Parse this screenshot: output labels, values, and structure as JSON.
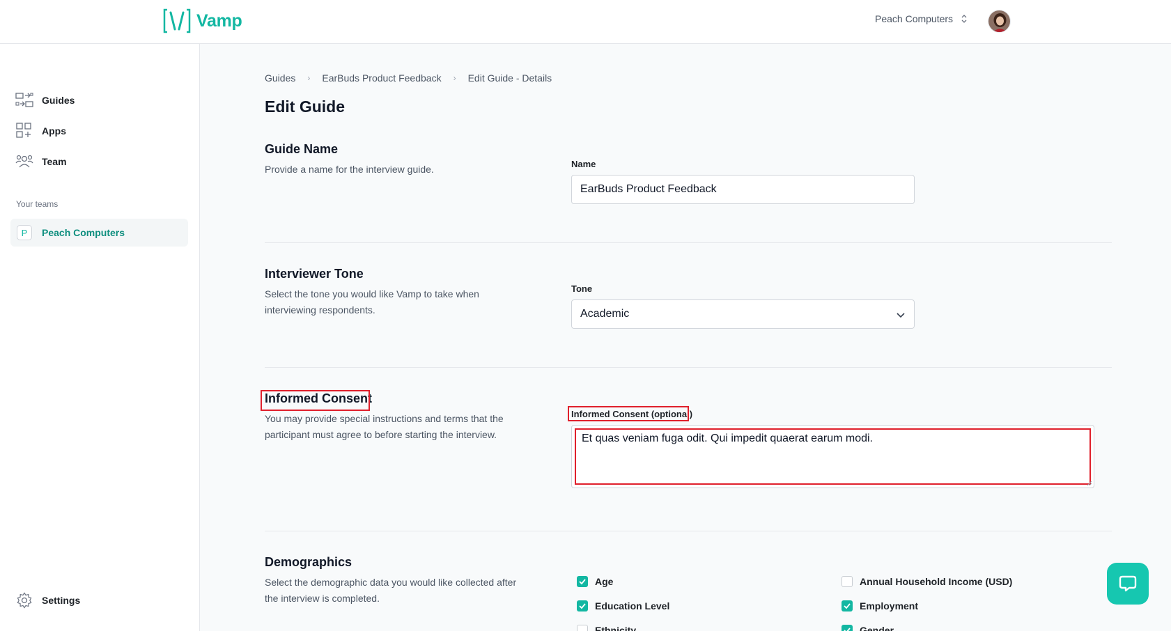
{
  "header": {
    "logo_text": "Vamp",
    "org_name": "Peach Computers",
    "brand_color": "#13b7a2"
  },
  "sidebar": {
    "items": [
      {
        "label": "Guides",
        "icon": "guides-icon"
      },
      {
        "label": "Apps",
        "icon": "apps-grid-icon"
      },
      {
        "label": "Team",
        "icon": "team-icon"
      }
    ],
    "teams_caption": "Your teams",
    "team": {
      "badge": "P",
      "label": "Peach Computers"
    },
    "settings_label": "Settings"
  },
  "breadcrumb": [
    "Guides",
    "EarBuds Product Feedback",
    "Edit Guide - Details"
  ],
  "page_title": "Edit Guide",
  "sections": {
    "guide_name": {
      "title": "Guide Name",
      "description": "Provide a name for the interview guide.",
      "field_label": "Name",
      "value": "EarBuds Product Feedback"
    },
    "tone": {
      "title": "Interviewer Tone",
      "description": "Select the tone you would like Vamp to take when interviewing respondents.",
      "field_label": "Tone",
      "value": "Academic"
    },
    "consent": {
      "title": "Informed Consent",
      "description": "You may provide special instructions and terms that the participant must agree to before starting the interview.",
      "field_label": "Informed Consent (optional)",
      "value": "Et quas veniam fuga odit. Qui impedit quaerat earum modi."
    },
    "demographics": {
      "title": "Demographics",
      "description": "Select the demographic data you would like collected after the interview is completed.",
      "options": [
        {
          "label": "Age",
          "checked": true
        },
        {
          "label": "Annual Household Income (USD)",
          "checked": false
        },
        {
          "label": "Education Level",
          "checked": true
        },
        {
          "label": "Employment",
          "checked": true
        },
        {
          "label": "Ethnicity",
          "checked": false
        },
        {
          "label": "Gender",
          "checked": true
        }
      ]
    }
  },
  "highlight_color": "#e0202c"
}
